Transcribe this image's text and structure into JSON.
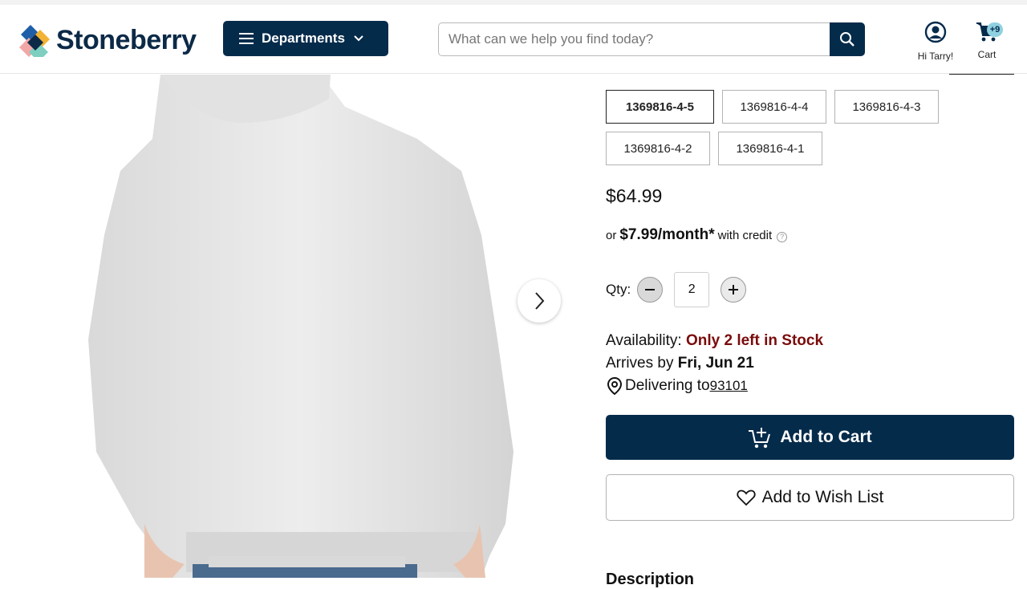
{
  "header": {
    "logo_text": "Stoneberry",
    "departments_label": "Departments",
    "search_placeholder": "What can we help you find today?",
    "account_label": "Hi Tarry!",
    "cart_label": "Cart",
    "cart_badge": "+9"
  },
  "product": {
    "sku_options": [
      {
        "label": "1369816-4-5",
        "selected": true
      },
      {
        "label": "1369816-4-4",
        "selected": false
      },
      {
        "label": "1369816-4-3",
        "selected": false
      },
      {
        "label": "1369816-4-2",
        "selected": false
      },
      {
        "label": "1369816-4-1",
        "selected": false
      }
    ],
    "price": "$64.99",
    "credit": {
      "prefix": "or",
      "amount": "$7.99/month*",
      "suffix": "with credit",
      "help": "?"
    },
    "qty": {
      "label": "Qty:",
      "value": "2"
    },
    "availability": {
      "label": "Availability:",
      "status": "Only 2 left in Stock"
    },
    "arrival": {
      "label": "Arrives by",
      "date": "Fri, Jun 21"
    },
    "delivery": {
      "label": "Delivering to",
      "zip": "93101"
    },
    "add_to_cart_label": "Add to Cart",
    "wish_list_label": "Add to Wish List",
    "description_heading": "Description"
  },
  "colors": {
    "brand_navy": "#052b4b",
    "stock_red": "#7a0b0b",
    "badge_blue": "#8fd1e0"
  }
}
